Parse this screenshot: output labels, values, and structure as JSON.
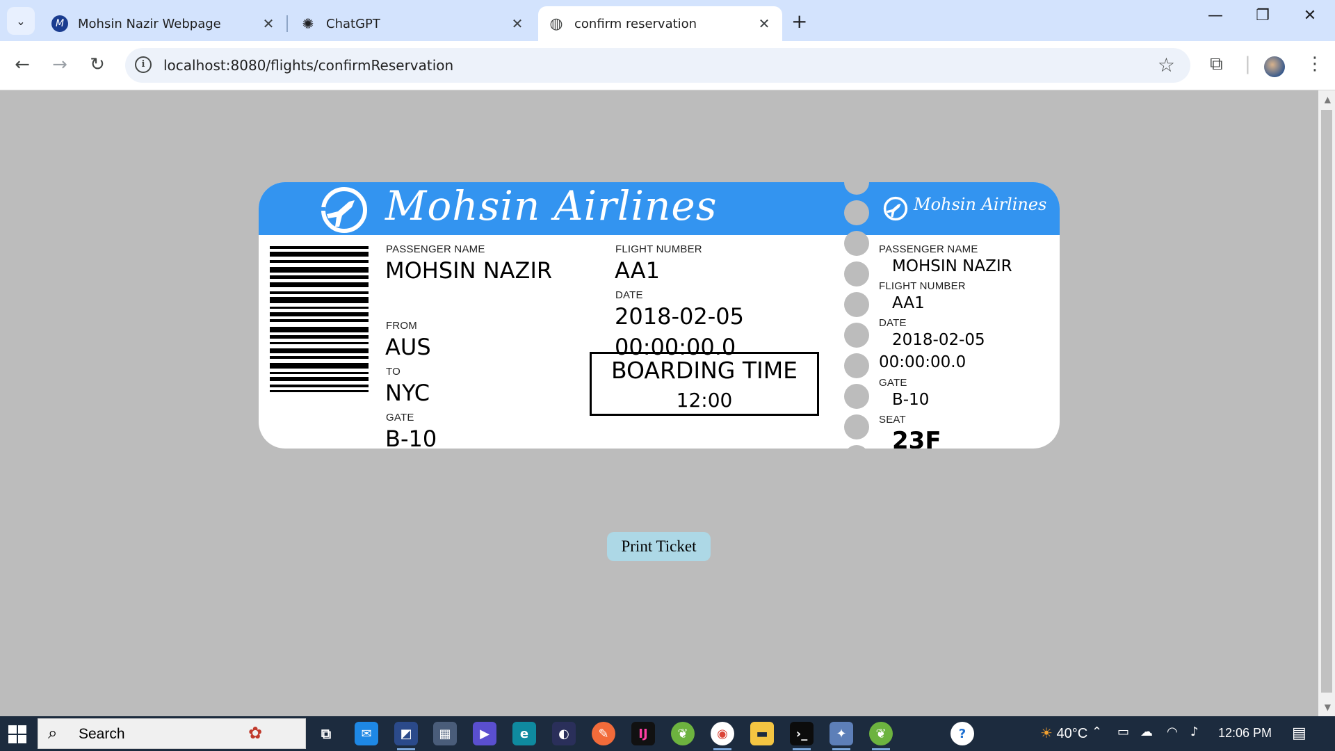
{
  "browser": {
    "tabs": [
      {
        "title": "Mohsin Nazir Webpage",
        "favicon": "M",
        "active": false
      },
      {
        "title": "ChatGPT",
        "favicon": "✺",
        "active": false
      },
      {
        "title": "confirm reservation",
        "favicon": "◍",
        "active": true
      }
    ],
    "url": "localhost:8080/flights/confirmReservation"
  },
  "ticket": {
    "airline_name": "Mohsin Airlines",
    "stub_airline_name": "Mohsin Airlines",
    "labels": {
      "passenger_name": "PASSENGER NAME",
      "flight_number": "FLIGHT NUMBER",
      "date": "DATE",
      "from": "FROM",
      "to": "TO",
      "gate": "GATE",
      "seat": "SEAT"
    },
    "passenger_name": "MOHSIN NAZIR",
    "flight_number": "AA1",
    "date": "2018-02-05",
    "time": "00:00:00.0",
    "from": "AUS",
    "to": "NYC",
    "gate": "B-10",
    "seat": "23F",
    "boarding_title": "BOARDING TIME",
    "boarding_time": "12:00"
  },
  "page": {
    "print_button": "Print Ticket"
  },
  "taskbar": {
    "search_text": "Search",
    "temperature": "40°C",
    "time": "12:06 PM"
  },
  "colors": {
    "ticket_header": "#3394f0",
    "page_background": "#bcbcbc",
    "print_button": "#add8e6",
    "tab_strip": "#d3e3fd"
  }
}
